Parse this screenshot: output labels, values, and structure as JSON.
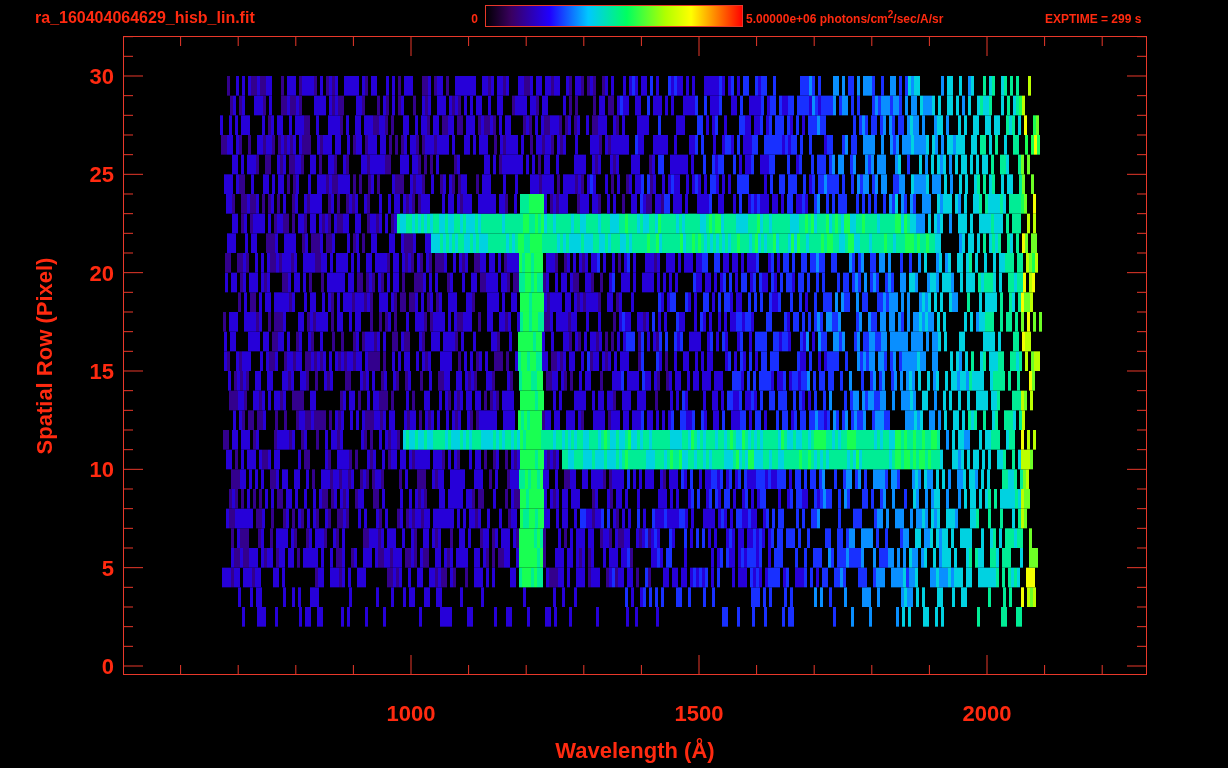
{
  "title": "ra_160404064629_hisb_lin.fit",
  "colorbar": {
    "min_label": "0",
    "max_label": "5.00000e+06 photons/cm$^{2}$/sec/A/sr"
  },
  "exptime": "EXPTIME = 299 s",
  "y_axis": {
    "title": "Spatial Row (Pixel)",
    "tick_labels": [
      "30",
      "25",
      "20",
      "15",
      "10",
      "5",
      "0"
    ]
  },
  "x_axis": {
    "title": "Wavelength (Å)",
    "tick_labels": [
      "1000",
      "1500",
      "2000"
    ]
  }
}
